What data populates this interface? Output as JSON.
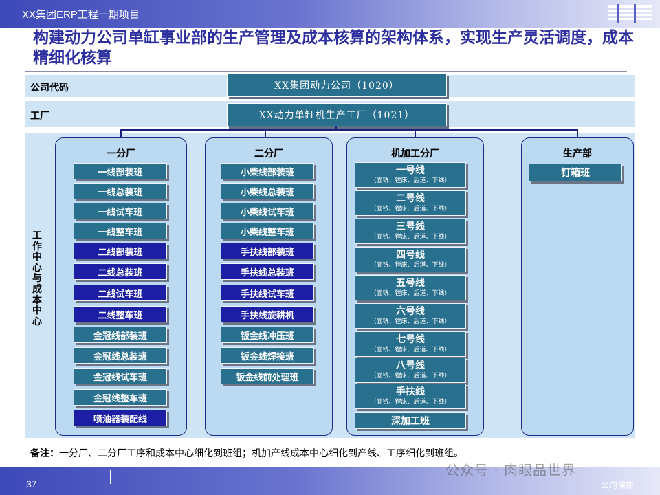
{
  "header": {
    "project": "XX集团ERP工程一期项目",
    "logo": "IBM"
  },
  "title": "构建动力公司单缸事业部的生产管理及成本核算的架构体系，实现生产灵活调度，成本精细化核算",
  "rows": {
    "company_code_label": "公司代码",
    "factory_label": "工厂",
    "work_center_label": "工作中心与成本中心"
  },
  "company": "XX集团动力公司（1020）",
  "factory": "XX动力单缸机生产工厂（1021）",
  "panels": {
    "p1": {
      "title": "一分厂",
      "items": [
        "一线部装班",
        "一线总装班",
        "一线试车班",
        "一线整车班",
        "二线部装班",
        "二线总装班",
        "二线试车班",
        "二线整车班",
        "金冠线部装班",
        "金冠线总装班",
        "金冠线试车班",
        "金冠线整车班",
        "喷油器装配线"
      ]
    },
    "p2": {
      "title": "二分厂",
      "items": [
        "小柴线部装班",
        "小柴线总装班",
        "小柴线试车班",
        "小柴线整车班",
        "手扶线部装班",
        "手扶线总装班",
        "手扶线试车班",
        "手扶线旋耕机",
        "钣金线冲压班",
        "钣金线焊接班",
        "钣金线前处理班"
      ]
    },
    "p3": {
      "title": "机加工分厂",
      "lines": [
        "一号线",
        "二号线",
        "三号线",
        "四号线",
        "五号线",
        "六号线",
        "七号线",
        "八号线",
        "手扶线"
      ],
      "line_sub": "（面铣、镗床、后道、下线）",
      "extra": "深加工班"
    },
    "p4": {
      "title": "生产部",
      "items": [
        "钉箱班"
      ]
    }
  },
  "note": {
    "label": "备注：",
    "text": "一分厂、二分厂工序和成本中心细化到班组；机加产线成本中心细化到产线、工序细化到班组。"
  },
  "footer": {
    "page": "37",
    "watermark": "公众号 · 肉眼品世界",
    "confidential": "公司保密"
  },
  "colors": {
    "teal": "#28708e",
    "navy": "#1c1fa4",
    "panel": "#bcd9f2",
    "band": "#cfe5f6",
    "title": "#2d2f9e"
  }
}
